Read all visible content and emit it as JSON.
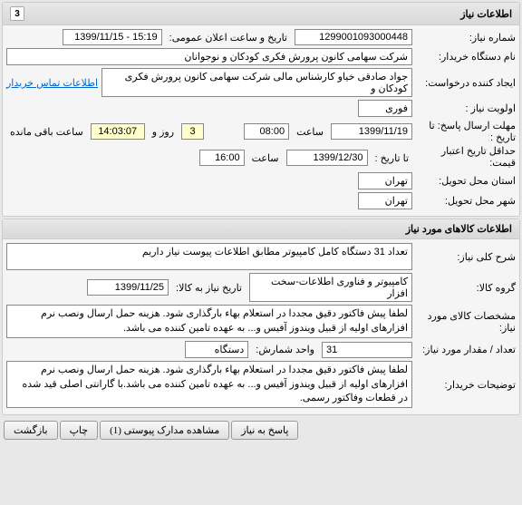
{
  "panel1": {
    "title": "اطلاعات نیاز",
    "num": "3",
    "needNumber_label": "شماره نیاز:",
    "needNumber": "1299001093000448",
    "announceTime_label": "تاریخ و ساعت اعلان عمومی:",
    "announceTime": "15:19 - 1399/11/15",
    "buyerOrg_label": "نام دستگاه خریدار:",
    "buyerOrg": "شرکت سهامی کانون پرورش فکری کودکان و نوجوانان",
    "requestCreator_label": "ایجاد کننده درخواست:",
    "requestCreator": "جواد صادقی خیاو کارشناس مالی شرکت سهامی کانون پرورش فکری کودکان و",
    "contactLink": "اطلاعات تماس خریدار",
    "priority_label": "اولویت نیاز :",
    "priority": "فوری",
    "deadline_label": "مهلت ارسال پاسخ: تا تاریخ :",
    "deadline_date": "1399/11/19",
    "deadline_time_label": "ساعت",
    "deadline_time": "08:00",
    "remaining_days": "3",
    "remaining_days_label": "روز و",
    "remaining_time": "14:03:07",
    "remaining_time_label": "ساعت باقی مانده",
    "minValidity_label": "حداقل تاریخ اعتبار قیمت:",
    "minValidity_from_label": "تا تاریخ :",
    "minValidity_date": "1399/12/30",
    "minValidity_time_label": "ساعت",
    "minValidity_time": "16:00",
    "deliveryProvince_label": "استان محل تحویل:",
    "deliveryProvince": "تهران",
    "deliveryCity_label": "شهر محل تحویل:",
    "deliveryCity": "تهران"
  },
  "panel2": {
    "title": "اطلاعات کالاهای مورد نیاز",
    "generalDesc_label": "شرح کلی نیاز:",
    "generalDesc": "تعداد 31 دستگاه کامل کامپیوتر مطابق اطلاعات پیوست نیاز داریم",
    "goodsGroup_label": "گروه کالا:",
    "goodsGroup": "کامپیوتر و فناوری اطلاعات-سخت افزار",
    "goodsDate_label": "تاریخ نیاز به کالا:",
    "goodsDate": "1399/11/25",
    "goodsSpec_label": "مشخصات کالای مورد نیاز:",
    "goodsSpec": "لطفا پیش فاکتور دقیق مجددا در استعلام بهاء بارگذاری شود. هزینه حمل ارسال ونصب نرم افزارهای اولیه از قبیل ویندوز آفیس و... به عهده تامین کننده می باشد.",
    "quantity_label": "تعداد / مقدار مورد نیاز:",
    "quantity": "31",
    "unit_label": "واحد شمارش:",
    "unit": "دستگاه",
    "buyerNotes_label": "توضیحات خریدار:",
    "buyerNotes": "لطفا پیش فاکتور دقیق مجددا در استعلام بهاء بارگذاری شود. هزینه حمل ارسال ونصب نرم افزارهای اولیه از قبیل ویندوز آفیس و... به عهده تامین کننده می باشد.با گارانتی اصلی قید شده در قطعات وفاکتور رسمی."
  },
  "buttons": {
    "respond": "پاسخ به نیاز",
    "attachments": "مشاهده مدارک پیوستی (1)",
    "print": "چاپ",
    "back": "بازگشت"
  }
}
